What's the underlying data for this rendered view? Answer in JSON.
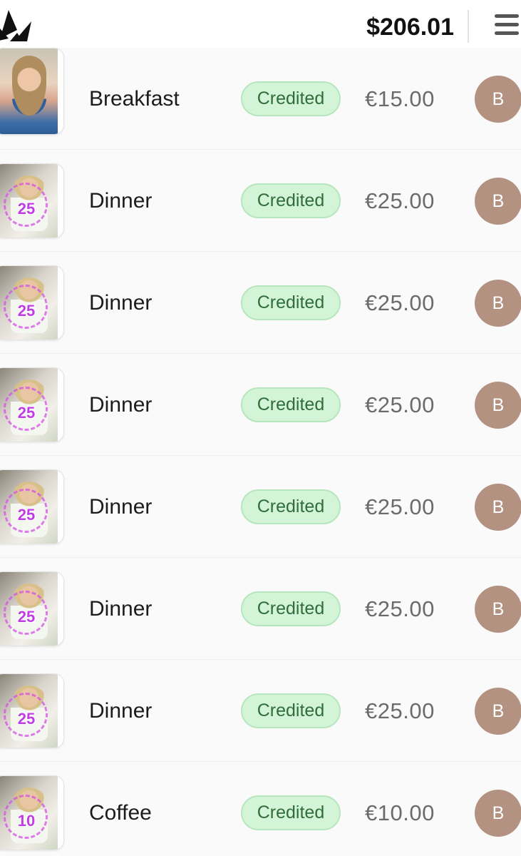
{
  "header": {
    "balance": "$206.01",
    "logo_icon": "crown-logo-icon",
    "menu_icon": "hamburger-menu-icon"
  },
  "colors": {
    "status_bg": "#d4f4d8",
    "status_text": "#2f6e3a",
    "avatar_bg": "#b39282",
    "badge_number": "#c23ce6"
  },
  "transactions": [
    {
      "title": "Breakfast",
      "status": "Credited",
      "amount": "€15.00",
      "avatar": "B",
      "thumb_badge": ""
    },
    {
      "title": "Dinner",
      "status": "Credited",
      "amount": "€25.00",
      "avatar": "B",
      "thumb_badge": "25"
    },
    {
      "title": "Dinner",
      "status": "Credited",
      "amount": "€25.00",
      "avatar": "B",
      "thumb_badge": "25"
    },
    {
      "title": "Dinner",
      "status": "Credited",
      "amount": "€25.00",
      "avatar": "B",
      "thumb_badge": "25"
    },
    {
      "title": "Dinner",
      "status": "Credited",
      "amount": "€25.00",
      "avatar": "B",
      "thumb_badge": "25"
    },
    {
      "title": "Dinner",
      "status": "Credited",
      "amount": "€25.00",
      "avatar": "B",
      "thumb_badge": "25"
    },
    {
      "title": "Dinner",
      "status": "Credited",
      "amount": "€25.00",
      "avatar": "B",
      "thumb_badge": "25"
    },
    {
      "title": "Coffee",
      "status": "Credited",
      "amount": "€10.00",
      "avatar": "B",
      "thumb_badge": "10"
    }
  ]
}
